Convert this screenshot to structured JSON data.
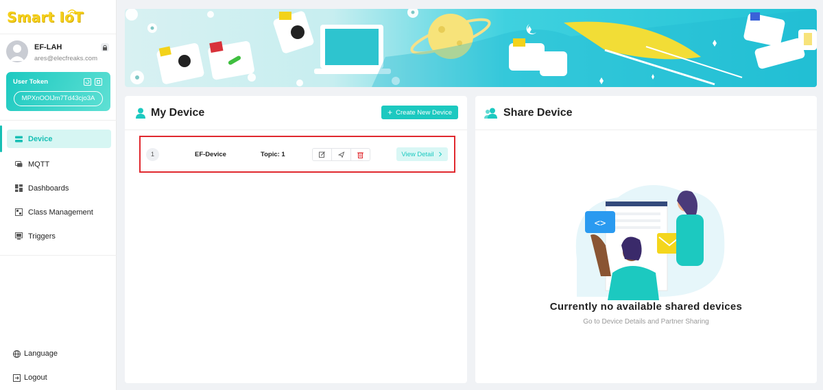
{
  "app": {
    "logo": "Smart IoT"
  },
  "user": {
    "name": "EF-LAH",
    "email": "ares@elecfreaks.com"
  },
  "token": {
    "title": "User Token",
    "value": "MPXnOOIJm7Td43cjo3A"
  },
  "nav": {
    "items": [
      {
        "label": "Device",
        "icon": "server-icon",
        "active": true
      },
      {
        "label": "MQTT",
        "icon": "chat-icon"
      },
      {
        "label": "Dashboards",
        "icon": "grid-icon"
      },
      {
        "label": "Class Management",
        "icon": "class-icon"
      },
      {
        "label": "Triggers",
        "icon": "monitor-icon"
      }
    ],
    "bottom": [
      {
        "label": "Language",
        "icon": "globe-icon"
      },
      {
        "label": "Logout",
        "icon": "logout-icon"
      }
    ]
  },
  "my_device": {
    "title": "My Device",
    "create_label": "Create New Device",
    "rows": [
      {
        "index": "1",
        "name": "EF-Device",
        "topic": "Topic: 1",
        "view_label": "View Detail"
      }
    ]
  },
  "share_device": {
    "title": "Share Device",
    "empty_title": "Currently no available shared devices",
    "empty_sub": "Go to Device Details and Partner Sharing"
  },
  "colors": {
    "accent": "#1cc9c0",
    "highlight": "#e0282e",
    "logo": "#f5d01c"
  }
}
